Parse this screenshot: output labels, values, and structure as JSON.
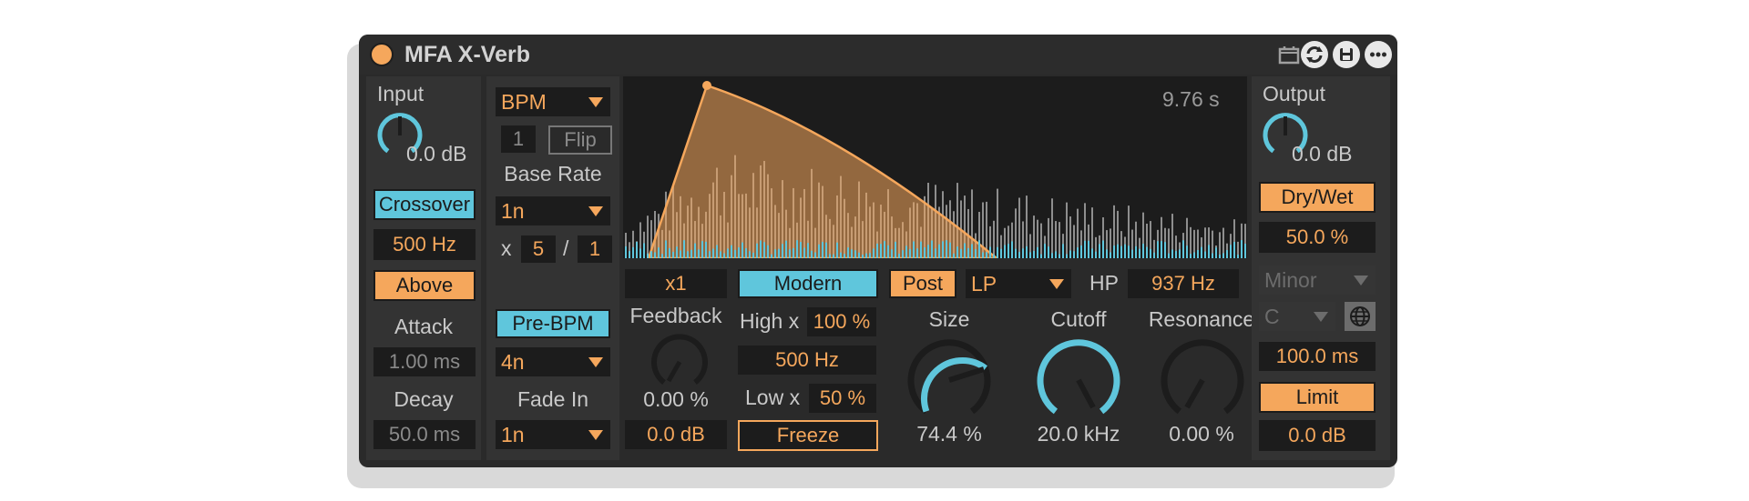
{
  "device": {
    "title": "MFA X-Verb",
    "icons": [
      "calendar-icon",
      "refresh-icon",
      "save-icon",
      "more-icon"
    ],
    "colors": {
      "accent_orange": "#f5a75c",
      "accent_blue": "#5fc6dc",
      "background": "#2a2a2a"
    }
  },
  "input": {
    "label": "Input",
    "value": "0.0 dB",
    "level": 0.0
  },
  "crossover": {
    "button": "Crossover",
    "freq": "500 Hz",
    "mode": "Above"
  },
  "envelope": {
    "attack_label": "Attack",
    "attack": "1.00 ms",
    "decay_label": "Decay",
    "decay": "50.0 ms"
  },
  "rate": {
    "sync_mode": "BPM",
    "count": "1",
    "flip": "Flip",
    "base_rate_label": "Base Rate",
    "base_rate": "1n",
    "mult_prefix": "x",
    "mult_num": "5",
    "mult_sep": "/",
    "mult_den": "1",
    "pre_bpm": "Pre-BPM",
    "pre_bpm_rate": "4n",
    "fade_in_label": "Fade In",
    "fade_in": "1n"
  },
  "display": {
    "time": "9.76 s"
  },
  "feedback": {
    "mult": "x1",
    "label": "Feedback",
    "value": "0.00 %",
    "gain": "0.0 dB",
    "level": 0.0
  },
  "mode": {
    "button": "Modern",
    "high_label": "High x",
    "high": "100 %",
    "freq": "500 Hz",
    "low_label": "Low x",
    "low": "50 %",
    "freeze": "Freeze"
  },
  "filter": {
    "post": "Post",
    "type": "LP",
    "hp_label": "HP",
    "hp_freq": "937 Hz"
  },
  "size": {
    "label": "Size",
    "value": "74.4 %",
    "level": 0.744
  },
  "cutoff": {
    "label": "Cutoff",
    "value": "20.0 kHz",
    "level": 1.0
  },
  "resonance": {
    "label": "Resonance",
    "value": "0.00 %",
    "level": 0.0
  },
  "output": {
    "label": "Output",
    "value": "0.0 dB",
    "level": 0.0,
    "dry_wet": "Dry/Wet",
    "dry_wet_value": "50.0 %",
    "scale": "Minor",
    "key": "C",
    "time": "100.0 ms",
    "limit": "Limit",
    "limit_gain": "0.0 dB"
  }
}
